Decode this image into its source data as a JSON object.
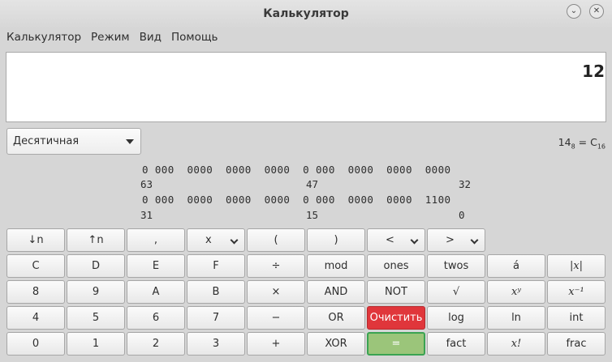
{
  "window": {
    "title": "Калькулятор",
    "minimize_glyph": "⌄",
    "close_glyph": "✕"
  },
  "menu": [
    "Калькулятор",
    "Режим",
    "Вид",
    "Помощь"
  ],
  "display": {
    "value": "12"
  },
  "base_select": {
    "selected": "Десятичная"
  },
  "conversion": {
    "from_value": "14",
    "from_base": "8",
    "eq": " = C",
    "to_base": "16"
  },
  "bits": {
    "row1": "0 000  0000  0000  0000  0 000  0000  0000  0000",
    "row2": "0 000  0000  0000  0000  0 000  0000  0000  1100",
    "row1_labels": [
      "63",
      "47",
      "32"
    ],
    "row2_labels": [
      "31",
      "15",
      "0"
    ]
  },
  "buttons": {
    "row1": [
      "↓n",
      "↑n",
      ",",
      "x",
      "(",
      ")",
      "<",
      ">"
    ],
    "row2": [
      "C",
      "D",
      "E",
      "F",
      "÷",
      "mod",
      "ones",
      "twos",
      "á",
      "|x|"
    ],
    "row3": [
      "8",
      "9",
      "A",
      "B",
      "×",
      "AND",
      "NOT",
      "√",
      "xʸ",
      "x⁻¹"
    ],
    "row4": [
      "4",
      "5",
      "6",
      "7",
      "−",
      "OR",
      "Очистить",
      "log",
      "ln",
      "int"
    ],
    "row5": [
      "0",
      "1",
      "2",
      "3",
      "+",
      "XOR",
      "=",
      "fact",
      "x!",
      "frac"
    ]
  },
  "colors": {
    "clear": "#e0363b",
    "equals": "#9bc57a",
    "equals_border": "#3aa352"
  }
}
